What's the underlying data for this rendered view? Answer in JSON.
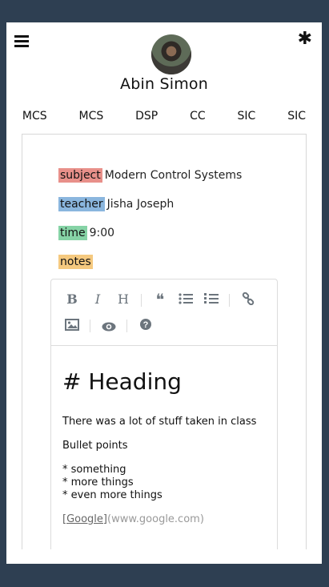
{
  "header": {
    "user_name": "Abin Simon",
    "menu_icon": "hamburger-menu-icon",
    "settings_icon": "asterisk-icon"
  },
  "tabs": [
    "MCS",
    "MCS",
    "DSP",
    "CC",
    "SIC",
    "SIC"
  ],
  "details": {
    "subject": {
      "label": "subject",
      "value": "Modern Control Systems",
      "color": "#e8908a"
    },
    "teacher": {
      "label": "teacher",
      "value": "Jisha Joseph",
      "color": "#8ab6de"
    },
    "time": {
      "label": "time",
      "value": "9:00",
      "color": "#86d3a6"
    },
    "notes": {
      "label": "notes",
      "color": "#f5c97f"
    }
  },
  "editor": {
    "toolbar_icons": [
      "bold-icon",
      "italic-icon",
      "heading-icon",
      "quote-icon",
      "unordered-list-icon",
      "ordered-list-icon",
      "link-icon",
      "image-icon",
      "preview-icon",
      "help-icon"
    ],
    "toolbar_glyphs": {
      "bold": "B",
      "italic": "I",
      "heading": "H",
      "quote": "❝",
      "help": "?"
    },
    "heading": "# Heading",
    "line1": "There was a lot of stuff taken in class",
    "line2": "Bullet points",
    "bullets": [
      "* something",
      "* more things",
      "* even more things"
    ],
    "link_text": "[Google]",
    "link_url": "(www.google.com)"
  }
}
